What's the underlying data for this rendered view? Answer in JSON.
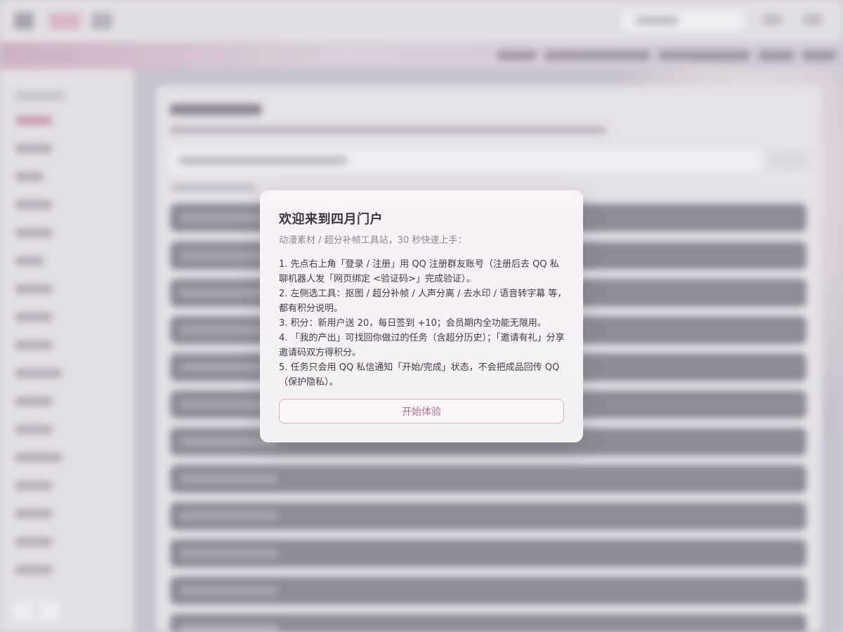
{
  "modal": {
    "title": "欢迎来到四月门户",
    "subtitle": "动漫素材 / 超分补帧工具站，30 秒快速上手：",
    "steps": [
      "1. 先点右上角「登录 / 注册」用 QQ 注册群友账号（注册后去 QQ 私聊机器人发「网页绑定 <验证码>」完成验证）。",
      "2. 左侧选工具：抠图 / 超分补帧 / 人声分离 / 去水印 / 语音转字幕 等，都有积分说明。",
      "3. 积分：新用户送 20，每日签到 +10；会员期内全功能无限用。",
      "4. 「我的产出」可找回你做过的任务（含超分历史）；「邀请有礼」分享邀请码双方得积分。",
      "5. 任务只会用 QQ 私信通知「开始/完成」状态，不会把成品回传 QQ（保护隐私）。"
    ],
    "start_button": "开始体验"
  },
  "theme": {
    "accent": "#b0708f",
    "accent_border": "#d7b2c3",
    "modal_bg": "#f7f3f6",
    "row_bar": "#8a8892"
  }
}
